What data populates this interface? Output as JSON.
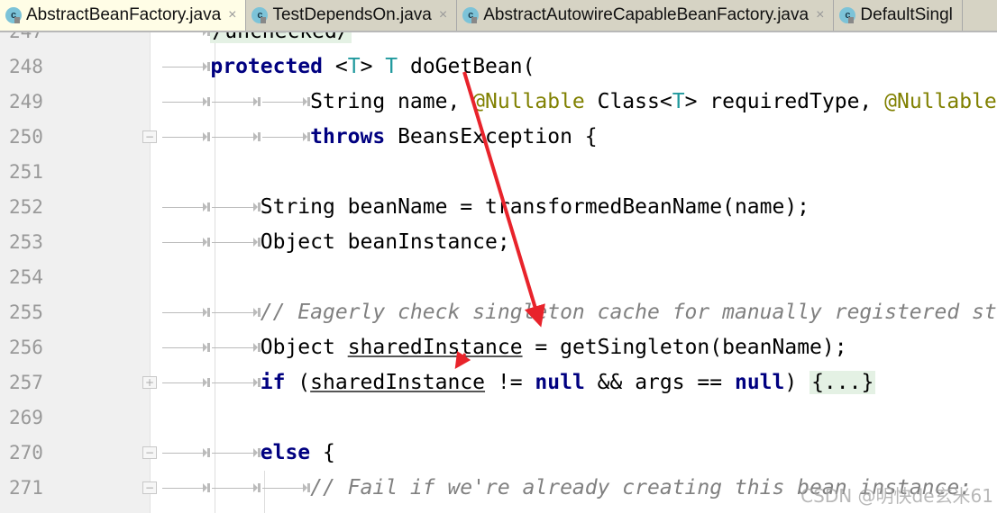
{
  "tabs": [
    {
      "label": "AbstractBeanFactory.java",
      "icon": "class-icon",
      "active": true,
      "close": "×"
    },
    {
      "label": "TestDependsOn.java",
      "icon": "class-icon",
      "active": false,
      "close": "×"
    },
    {
      "label": "AbstractAutowireCapableBeanFactory.java",
      "icon": "class-icon",
      "active": false,
      "close": "×"
    },
    {
      "label": "DefaultSingl",
      "icon": "class-icon",
      "active": false,
      "close": ""
    }
  ],
  "class_icon_letter": "c",
  "lines": [
    {
      "num": "247",
      "indent": 1,
      "tokens": [
        {
          "t": "/unchecked/",
          "c": "fold"
        }
      ]
    },
    {
      "num": "248",
      "indent": 1,
      "tokens": [
        {
          "t": "protected",
          "c": "kw"
        },
        {
          "t": " <"
        },
        {
          "t": "T",
          "c": "tp"
        },
        {
          "t": "> "
        },
        {
          "t": "T",
          "c": "tp"
        },
        {
          "t": " doGetBean("
        }
      ]
    },
    {
      "num": "249",
      "indent": 3,
      "tokens": [
        {
          "t": "String name, "
        },
        {
          "t": "@Nullable",
          "c": "ann"
        },
        {
          "t": " Class<"
        },
        {
          "t": "T",
          "c": "tp"
        },
        {
          "t": "> requiredType, "
        },
        {
          "t": "@Nullable",
          "c": "ann"
        }
      ]
    },
    {
      "num": "250",
      "indent": 3,
      "fold": "−",
      "tokens": [
        {
          "t": "throws",
          "c": "kw"
        },
        {
          "t": " BeansException {"
        }
      ]
    },
    {
      "num": "251",
      "indent": 0,
      "tokens": []
    },
    {
      "num": "252",
      "indent": 2,
      "tokens": [
        {
          "t": "String beanName = transformedBeanName(name);"
        }
      ]
    },
    {
      "num": "253",
      "indent": 2,
      "tokens": [
        {
          "t": "Object beanInstance;"
        }
      ]
    },
    {
      "num": "254",
      "indent": 0,
      "tokens": []
    },
    {
      "num": "255",
      "indent": 2,
      "tokens": [
        {
          "t": "// Eagerly check singleton cache for manually registered st",
          "c": "cm"
        }
      ]
    },
    {
      "num": "256",
      "indent": 2,
      "tokens": [
        {
          "t": "Object "
        },
        {
          "t": "sharedInstance",
          "c": "und"
        },
        {
          "t": " = getSingleton(beanName);"
        }
      ]
    },
    {
      "num": "257",
      "indent": 2,
      "fold": "+",
      "tokens": [
        {
          "t": "if",
          "c": "kw"
        },
        {
          "t": " ("
        },
        {
          "t": "sharedInstance",
          "c": "und"
        },
        {
          "t": " != "
        },
        {
          "t": "null",
          "c": "kw"
        },
        {
          "t": " && args == "
        },
        {
          "t": "null",
          "c": "kw"
        },
        {
          "t": ") "
        },
        {
          "t": "{...}",
          "c": "fold"
        }
      ]
    },
    {
      "num": "269",
      "indent": 0,
      "tokens": []
    },
    {
      "num": "270",
      "indent": 2,
      "fold": "−",
      "tokens": [
        {
          "t": "else",
          "c": "kw"
        },
        {
          "t": " {"
        }
      ]
    },
    {
      "num": "271",
      "indent": 3,
      "fold": "−",
      "tokens": [
        {
          "t": "// Fail if we're already creating this bean instance:",
          "c": "cm"
        }
      ]
    }
  ],
  "annotation_color": "#e8232b",
  "watermark": "CSDN @明快de玄米61"
}
